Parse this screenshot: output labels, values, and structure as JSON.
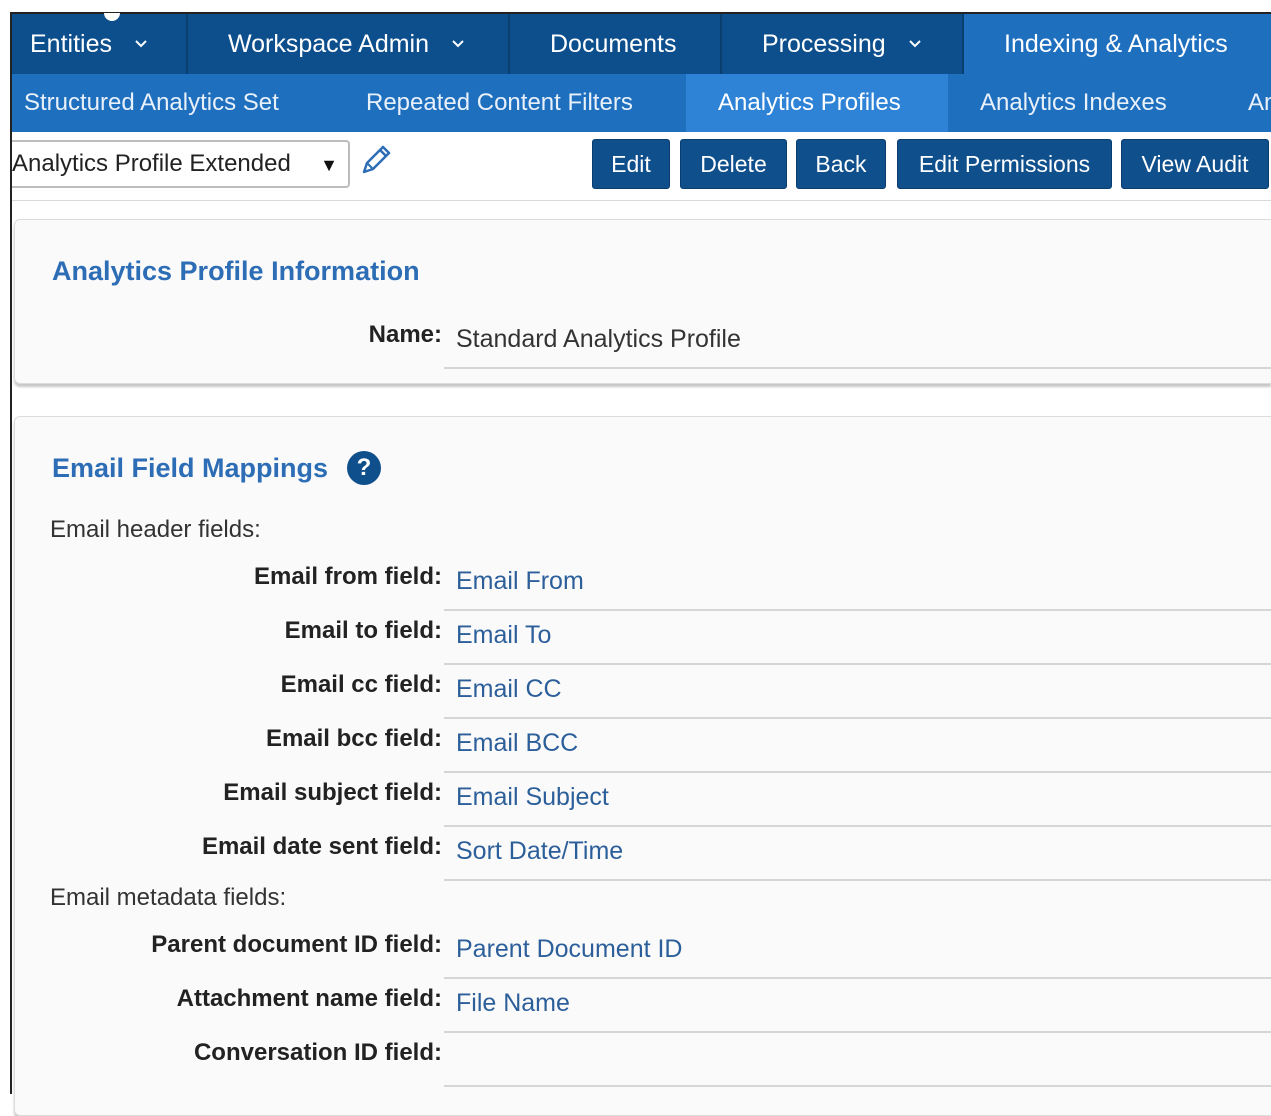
{
  "topnav": {
    "items": [
      {
        "label": "Entities",
        "has_dropdown": true
      },
      {
        "label": "Workspace Admin",
        "has_dropdown": true
      },
      {
        "label": "Documents",
        "has_dropdown": false
      },
      {
        "label": "Processing",
        "has_dropdown": true
      },
      {
        "label": "Indexing & Analytics",
        "has_dropdown": false,
        "active": true
      }
    ]
  },
  "subnav": {
    "items": [
      {
        "label": "Structured Analytics Set"
      },
      {
        "label": "Repeated Content Filters"
      },
      {
        "label": "Analytics Profiles",
        "active": true
      },
      {
        "label": "Analytics Indexes"
      },
      {
        "label": "An"
      }
    ]
  },
  "toolbar": {
    "view_select": "Analytics Profile Extended",
    "buttons": {
      "edit": "Edit",
      "delete": "Delete",
      "back": "Back",
      "edit_permissions": "Edit Permissions",
      "view_audit": "View Audit"
    }
  },
  "profile_info": {
    "title": "Analytics Profile Information",
    "name_label": "Name:",
    "name_value": "Standard Analytics Profile"
  },
  "email_mappings": {
    "title": "Email Field Mappings",
    "help_icon": "?",
    "header_section": "Email header fields:",
    "header_fields": [
      {
        "label": "Email from field:",
        "value": "Email From"
      },
      {
        "label": "Email to field:",
        "value": "Email To"
      },
      {
        "label": "Email cc field:",
        "value": "Email CC"
      },
      {
        "label": "Email bcc field:",
        "value": "Email BCC"
      },
      {
        "label": "Email subject field:",
        "value": "Email Subject"
      },
      {
        "label": "Email date sent field:",
        "value": "Sort Date/Time"
      }
    ],
    "metadata_section": "Email metadata fields:",
    "metadata_fields": [
      {
        "label": "Parent document ID field:",
        "value": "Parent Document ID"
      },
      {
        "label": "Attachment name field:",
        "value": "File Name"
      },
      {
        "label": "Conversation ID field:",
        "value": ""
      }
    ]
  },
  "colors": {
    "topnav_bg": "#0d4f8c",
    "subnav_bg": "#1f6fbf",
    "active_tab": "#2f83d6",
    "button_bg": "#0f4f8c",
    "title_text": "#2c6db5",
    "link_value": "#2c5f9a"
  }
}
